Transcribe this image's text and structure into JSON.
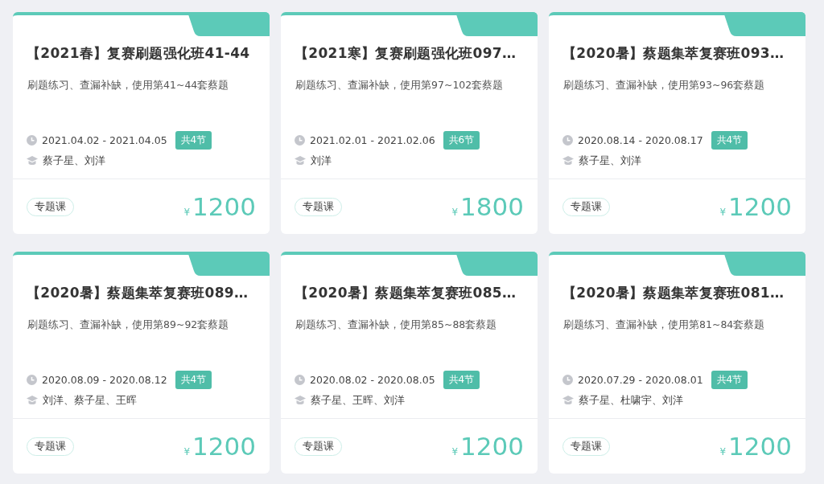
{
  "courses": [
    {
      "title": "【2021春】复赛刷题强化班41-44",
      "description": "刷题练习、查漏补缺，使用第41~44套蔡题",
      "dates": "2021.04.02 - 2021.04.05",
      "lessons": "共4节",
      "teachers": "蔡子星、刘洋",
      "tag": "专题课",
      "currency": "¥",
      "price": "1200"
    },
    {
      "title": "【2021寒】复赛刷题强化班097…",
      "description": "刷题练习、查漏补缺，使用第97~102套蔡题",
      "dates": "2021.02.01 - 2021.02.06",
      "lessons": "共6节",
      "teachers": "刘洋",
      "tag": "专题课",
      "currency": "¥",
      "price": "1800"
    },
    {
      "title": "【2020暑】蔡题集萃复赛班093…",
      "description": "刷题练习、查漏补缺，使用第93~96套蔡题",
      "dates": "2020.08.14 - 2020.08.17",
      "lessons": "共4节",
      "teachers": "蔡子星、刘洋",
      "tag": "专题课",
      "currency": "¥",
      "price": "1200"
    },
    {
      "title": "【2020暑】蔡题集萃复赛班089…",
      "description": "刷题练习、查漏补缺，使用第89~92套蔡题",
      "dates": "2020.08.09 - 2020.08.12",
      "lessons": "共4节",
      "teachers": "刘洋、蔡子星、王晖",
      "tag": "专题课",
      "currency": "¥",
      "price": "1200"
    },
    {
      "title": "【2020暑】蔡题集萃复赛班085…",
      "description": "刷题练习、查漏补缺，使用第85~88套蔡题",
      "dates": "2020.08.02 - 2020.08.05",
      "lessons": "共4节",
      "teachers": "蔡子星、王晖、刘洋",
      "tag": "专题课",
      "currency": "¥",
      "price": "1200"
    },
    {
      "title": "【2020暑】蔡题集萃复赛班081…",
      "description": "刷题练习、查漏补缺，使用第81~84套蔡题",
      "dates": "2020.07.29 - 2020.08.01",
      "lessons": "共4节",
      "teachers": "蔡子星、杜啸宇、刘洋",
      "tag": "专题课",
      "currency": "¥",
      "price": "1200"
    }
  ]
}
